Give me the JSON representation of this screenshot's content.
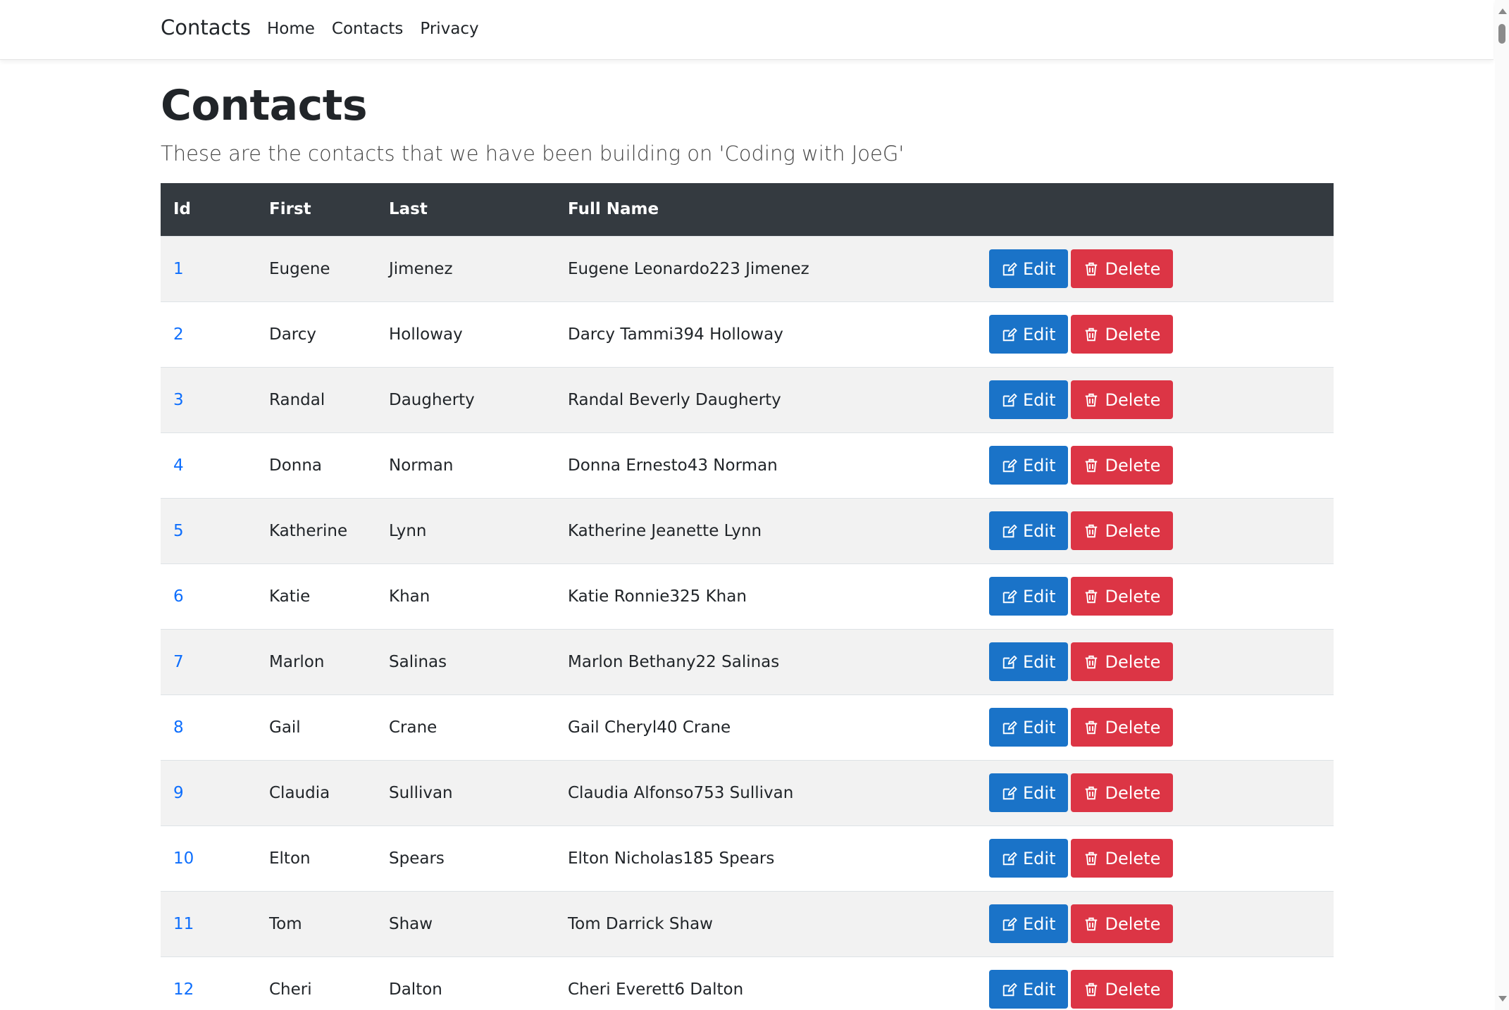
{
  "navbar": {
    "brand": "Contacts",
    "links": [
      "Home",
      "Contacts",
      "Privacy"
    ]
  },
  "page": {
    "title": "Contacts",
    "subtitle": "These are the contacts that we have been building on 'Coding with JoeG'"
  },
  "table": {
    "headers": [
      "Id",
      "First",
      "Last",
      "Full Name",
      ""
    ],
    "edit_label": "Edit",
    "delete_label": "Delete",
    "rows": [
      {
        "id": "1",
        "first": "Eugene",
        "last": "Jimenez",
        "full": "Eugene Leonardo223 Jimenez"
      },
      {
        "id": "2",
        "first": "Darcy",
        "last": "Holloway",
        "full": "Darcy Tammi394 Holloway"
      },
      {
        "id": "3",
        "first": "Randal",
        "last": "Daugherty",
        "full": "Randal Beverly Daugherty"
      },
      {
        "id": "4",
        "first": "Donna",
        "last": "Norman",
        "full": "Donna Ernesto43 Norman"
      },
      {
        "id": "5",
        "first": "Katherine",
        "last": "Lynn",
        "full": "Katherine Jeanette Lynn"
      },
      {
        "id": "6",
        "first": "Katie",
        "last": "Khan",
        "full": "Katie Ronnie325 Khan"
      },
      {
        "id": "7",
        "first": "Marlon",
        "last": "Salinas",
        "full": "Marlon Bethany22 Salinas"
      },
      {
        "id": "8",
        "first": "Gail",
        "last": "Crane",
        "full": "Gail Cheryl40 Crane"
      },
      {
        "id": "9",
        "first": "Claudia",
        "last": "Sullivan",
        "full": "Claudia Alfonso753 Sullivan"
      },
      {
        "id": "10",
        "first": "Elton",
        "last": "Spears",
        "full": "Elton Nicholas185 Spears"
      },
      {
        "id": "11",
        "first": "Tom",
        "last": "Shaw",
        "full": "Tom Darrick Shaw"
      },
      {
        "id": "12",
        "first": "Cheri",
        "last": "Dalton",
        "full": "Cheri Everett6 Dalton"
      }
    ]
  },
  "colors": {
    "header_bg": "#343a40",
    "edit_button": "#1a73c8",
    "delete_button": "#dc3545",
    "link": "#0d6efd"
  },
  "icons": {
    "edit": "pencil-square-icon",
    "delete": "trash-icon"
  }
}
